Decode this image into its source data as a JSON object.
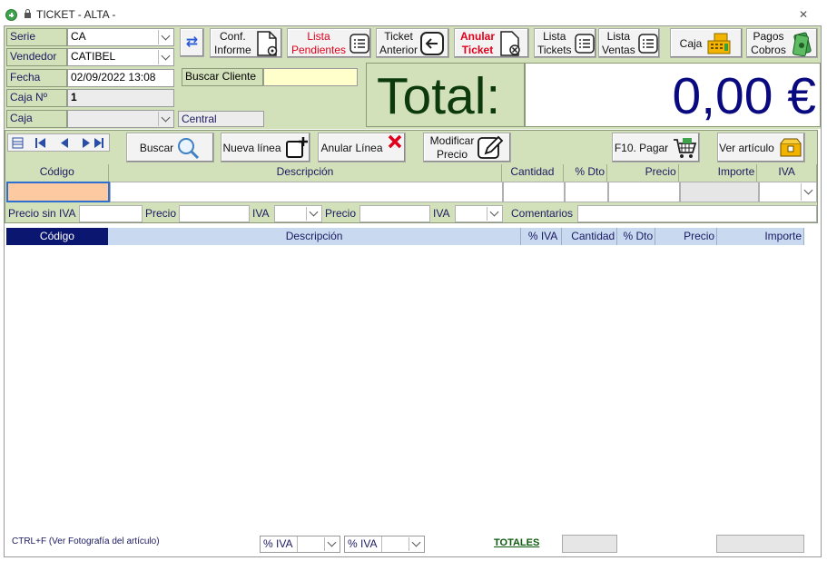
{
  "window": {
    "title": "TICKET - ALTA -"
  },
  "form": {
    "serie_label": "Serie",
    "serie_value": "CA",
    "vendedor_label": "Vendedor",
    "vendedor_value": "CATIBEL",
    "fecha_label": "Fecha",
    "fecha_value": "02/09/2022 13:08",
    "caja_no_label": "Caja Nº",
    "caja_no_value": "1",
    "caja_label": "Caja",
    "caja_value": "",
    "central_text": "Central",
    "buscar_cliente_label": "Buscar Cliente",
    "buscar_cliente_value": ""
  },
  "toolbar": {
    "conf_informe": [
      "Conf.",
      "Informe"
    ],
    "lista_pendientes": [
      "Lista",
      "Pendientes"
    ],
    "ticket_anterior": [
      "Ticket",
      "Anterior"
    ],
    "anular_ticket": [
      "Anular",
      "Ticket"
    ],
    "lista_tickets": [
      "Lista",
      "Tickets"
    ],
    "lista_ventas": [
      "Lista",
      "Ventas"
    ],
    "caja": "Caja",
    "pagos_cobros": [
      "Pagos",
      "Cobros"
    ]
  },
  "total": {
    "label": "Total:",
    "value": "0,00 €"
  },
  "actions": {
    "buscar": "Buscar",
    "nueva_linea": "Nueva línea",
    "anular_linea": "Anular Línea",
    "modificar_precio": [
      "Modificar",
      "Precio"
    ],
    "pagar": "F10. Pagar",
    "ver_articulo": "Ver artículo"
  },
  "entry_headers": [
    "Código",
    "Descripción",
    "Cantidad",
    "% Dto",
    "Precio",
    "Importe",
    "IVA"
  ],
  "price_row": {
    "precio_sin_iva": "Precio sin IVA",
    "precio1": "Precio",
    "iva1": "IVA",
    "precio2": "Precio",
    "iva2": "IVA",
    "comentarios": "Comentarios"
  },
  "grid_headers": [
    "Código",
    "Descripción",
    "% IVA",
    "Cantidad",
    "% Dto",
    "Precio",
    "Importe"
  ],
  "grid_rows": [],
  "footer": {
    "hint": "CTRL+F (Ver Fotografía del artículo)",
    "iva1": "% IVA",
    "iva2": "% IVA",
    "totales": "TOTALES"
  },
  "colors": {
    "accent_red": "#e0001b",
    "total_green": "#0d3a0d",
    "total_blue": "#0a0a80"
  }
}
